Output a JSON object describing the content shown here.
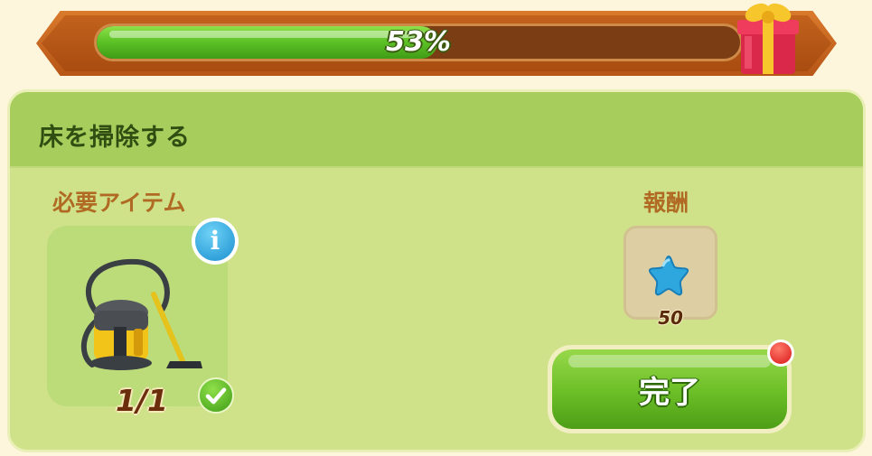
{
  "progress": {
    "percent": 53,
    "label": "53%"
  },
  "task": {
    "title": "床を掃除する"
  },
  "required": {
    "heading": "必要アイテム",
    "item_icon": "vacuum-cleaner-icon",
    "count": "1/1",
    "status": "complete"
  },
  "reward": {
    "heading": "報酬",
    "icon": "blue-star-icon",
    "amount": "50"
  },
  "actions": {
    "complete_label": "完了"
  },
  "colors": {
    "progress_fill": "#5ec427",
    "panel": "#cfe289",
    "header": "#a7cd5d",
    "button": "#6bbe26",
    "star": "#2ea6de"
  }
}
